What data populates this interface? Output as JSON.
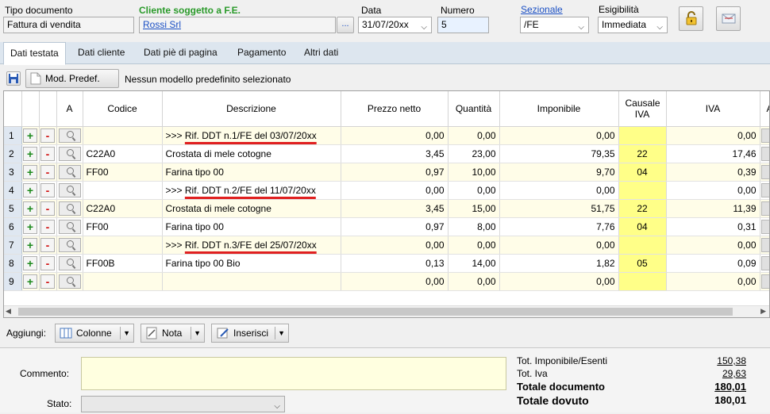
{
  "header": {
    "tipo_documento_label": "Tipo documento",
    "tipo_documento_value": "Fattura di vendita",
    "cliente_label": "Cliente soggetto a F.E.",
    "cliente_value": "Rossi Srl",
    "cliente_button": "...",
    "data_label": "Data",
    "data_value": "31/07/20xx",
    "numero_label": "Numero",
    "numero_value": "5",
    "sezionale_label": "Sezionale",
    "sezionale_value": "/FE",
    "esigibilita_label": "Esigibilità",
    "esigibilita_value": "Immediata"
  },
  "tabs": [
    "Dati testata",
    "Dati cliente",
    "Dati piè di pagina",
    "Pagamento",
    "Altri dati"
  ],
  "toolbar": {
    "mod_predef_label": "Mod. Predef.",
    "status_text": "Nessun modello predefinito selezionato"
  },
  "columns": [
    "A",
    "Codice",
    "Descrizione",
    "Prezzo netto",
    "Quantità",
    "Imponibile",
    "Causale IVA",
    "IVA",
    "Altri"
  ],
  "rows": [
    {
      "n": "1",
      "codice": "",
      "descr_prefix": ">>> ",
      "descr": "Rif. DDT n.1/FE del 03/07/20xx",
      "ref": true,
      "prezzo": "0,00",
      "qta": "0,00",
      "imponibile": "0,00",
      "causale": "",
      "iva": "0,00"
    },
    {
      "n": "2",
      "codice": "C22A0",
      "descr_prefix": "",
      "descr": "Crostata di mele cotogne",
      "ref": false,
      "prezzo": "3,45",
      "qta": "23,00",
      "imponibile": "79,35",
      "causale": "22",
      "iva": "17,46"
    },
    {
      "n": "3",
      "codice": "FF00",
      "descr_prefix": "",
      "descr": "Farina tipo 00",
      "ref": false,
      "prezzo": "0,97",
      "qta": "10,00",
      "imponibile": "9,70",
      "causale": "04",
      "iva": "0,39"
    },
    {
      "n": "4",
      "codice": "",
      "descr_prefix": ">>> ",
      "descr": "Rif. DDT n.2/FE del 11/07/20xx",
      "ref": true,
      "prezzo": "0,00",
      "qta": "0,00",
      "imponibile": "0,00",
      "causale": "",
      "iva": "0,00"
    },
    {
      "n": "5",
      "codice": "C22A0",
      "descr_prefix": "",
      "descr": "Crostata di mele cotogne",
      "ref": false,
      "prezzo": "3,45",
      "qta": "15,00",
      "imponibile": "51,75",
      "causale": "22",
      "iva": "11,39"
    },
    {
      "n": "6",
      "codice": "FF00",
      "descr_prefix": "",
      "descr": "Farina tipo 00",
      "ref": false,
      "prezzo": "0,97",
      "qta": "8,00",
      "imponibile": "7,76",
      "causale": "04",
      "iva": "0,31"
    },
    {
      "n": "7",
      "codice": "",
      "descr_prefix": ">>> ",
      "descr": "Rif. DDT n.3/FE del 25/07/20xx",
      "ref": true,
      "prezzo": "0,00",
      "qta": "0,00",
      "imponibile": "0,00",
      "causale": "",
      "iva": "0,00"
    },
    {
      "n": "8",
      "codice": "FF00B",
      "descr_prefix": "",
      "descr": "Farina tipo 00 Bio",
      "ref": false,
      "prezzo": "0,13",
      "qta": "14,00",
      "imponibile": "1,82",
      "causale": "05",
      "iva": "0,09"
    },
    {
      "n": "9",
      "codice": "",
      "descr_prefix": "",
      "descr": "",
      "ref": false,
      "prezzo": "0,00",
      "qta": "0,00",
      "imponibile": "0,00",
      "causale": "",
      "iva": "0,00"
    }
  ],
  "row_buttons": {
    "plus": "+",
    "minus": "-"
  },
  "aggiungi": {
    "label": "Aggiungi:",
    "colonne": "Colonne",
    "nota": "Nota",
    "inserisci": "Inserisci"
  },
  "footer": {
    "commento_label": "Commento:",
    "stato_label": "Stato:",
    "tot_imponibile_label": "Tot. Imponibile/Esenti",
    "tot_imponibile_value": "150,38",
    "tot_iva_label": "Tot. Iva",
    "tot_iva_value": "29,63",
    "totale_documento_label": "Totale documento",
    "totale_documento_value": "180,01",
    "totale_dovuto_label": "Totale dovuto",
    "totale_dovuto_value": "180,01"
  },
  "colors": {
    "fe_green": "#2a9a2a",
    "link_blue": "#1a4fc4",
    "causale_yellow": "#ffff88",
    "tab_bar": "#dde6ef"
  }
}
